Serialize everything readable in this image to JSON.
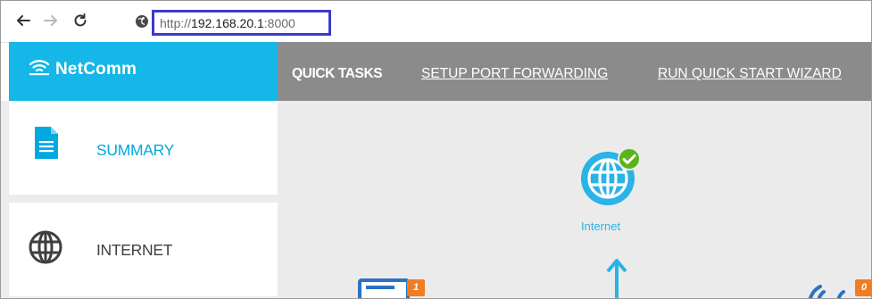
{
  "browser": {
    "url_scheme": "http://",
    "url_host": "192.168.20.1",
    "url_port": ":8000"
  },
  "brand": {
    "name": "NetComm"
  },
  "topnav": {
    "quick_tasks": "QUICK TASKS",
    "links": [
      "SETUP PORT FORWARDING",
      "RUN QUICK START WIZARD"
    ]
  },
  "sidebar": {
    "items": [
      {
        "label": "SUMMARY",
        "icon": "document-icon"
      },
      {
        "label": "INTERNET",
        "icon": "globe-icon"
      }
    ]
  },
  "main": {
    "internet_label": "Internet",
    "badges": [
      "1",
      "0"
    ]
  },
  "colors": {
    "brand_blue": "#14b7e8",
    "nav_gray": "#8b8b8b",
    "accent": "#00a8e0",
    "status_ok": "#5bb318",
    "badge_orange": "#f07d24",
    "url_highlight": "#3b3bc8"
  }
}
